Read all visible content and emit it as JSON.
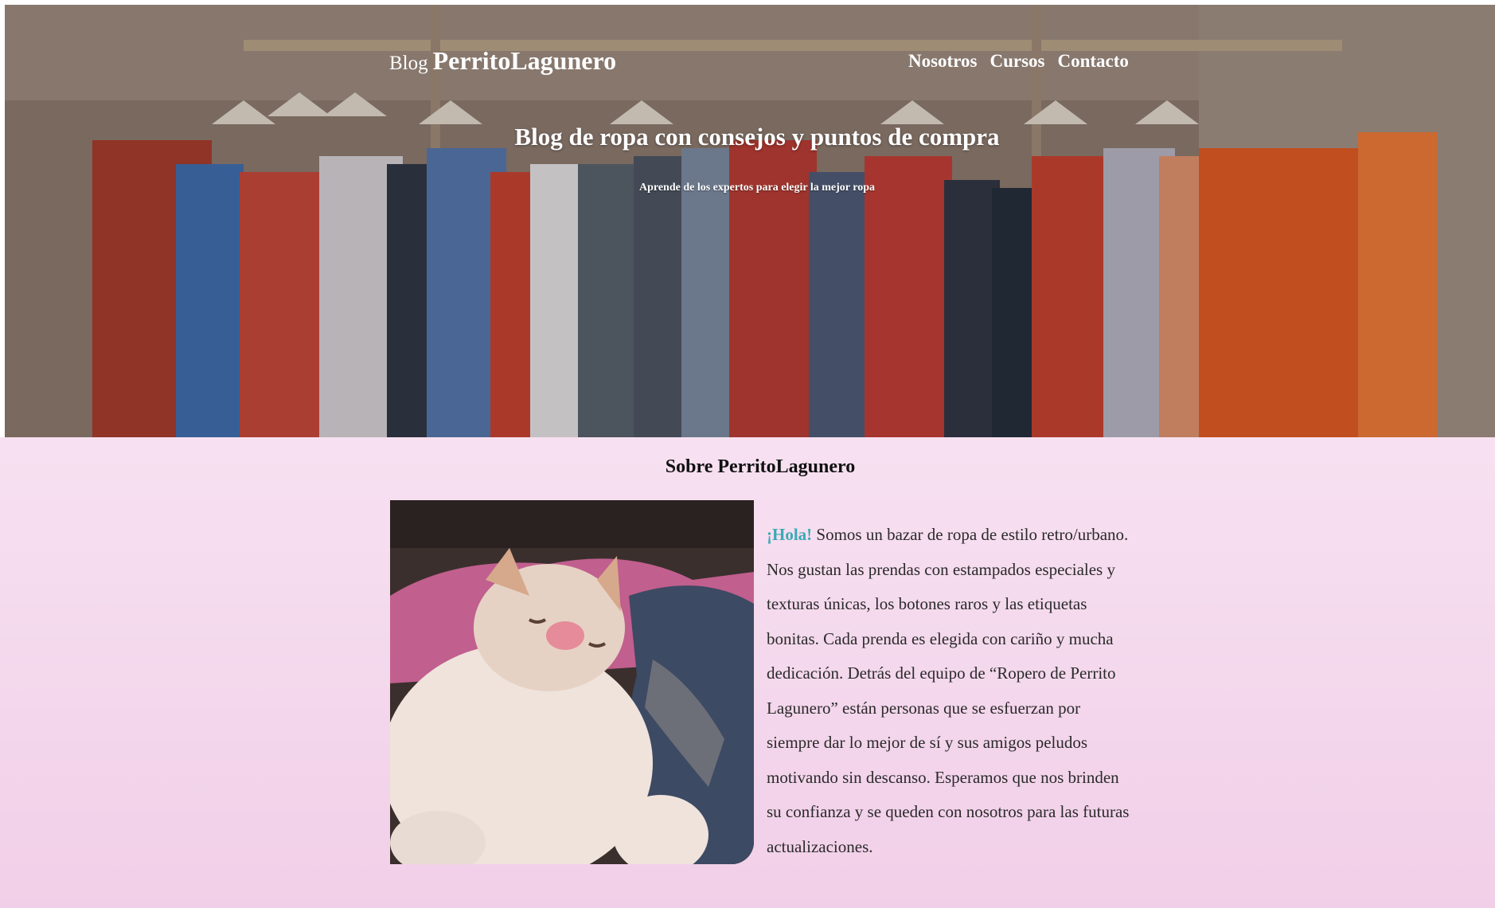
{
  "header": {
    "brand_prefix": "Blog",
    "brand_name": "PerritoLagunero",
    "nav": [
      {
        "label": "Nosotros"
      },
      {
        "label": "Cursos"
      },
      {
        "label": "Contacto"
      }
    ]
  },
  "hero": {
    "title": "Blog de ropa con consejos y puntos de compra",
    "subtitle": "Aprende de los expertos para elegir la mejor ropa"
  },
  "about": {
    "title": "Sobre PerritoLagunero",
    "greeting": "¡Hola!",
    "body": " Somos un bazar de ropa de estilo retro/urbano. Nos gustan las prendas con estampados especiales y texturas únicas, los botones raros y las etiquetas bonitas. Cada prenda es elegida con cariño y mucha dedicación. Detrás del equipo de “Ropero de Perrito Lagunero” están personas que se esfuerzan por siempre dar lo mejor de sí y sus amigos peludos motivando sin descanso. Esperamos que nos brinden su confianza y se queden con nosotros para las futuras actualizaciones."
  },
  "colors": {
    "greeting": "#3aaab5",
    "about_bg_top": "#f7e1f1",
    "about_bg_bottom": "#f1cfe8"
  }
}
